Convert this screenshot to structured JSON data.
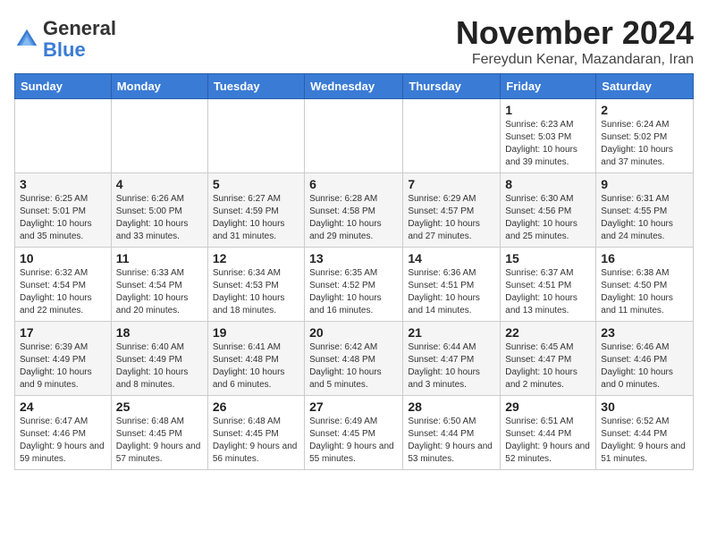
{
  "logo": {
    "general": "General",
    "blue": "Blue"
  },
  "header": {
    "month_title": "November 2024",
    "subtitle": "Fereydun Kenar, Mazandaran, Iran"
  },
  "days_of_week": [
    "Sunday",
    "Monday",
    "Tuesday",
    "Wednesday",
    "Thursday",
    "Friday",
    "Saturday"
  ],
  "weeks": [
    [
      {
        "day": "",
        "info": ""
      },
      {
        "day": "",
        "info": ""
      },
      {
        "day": "",
        "info": ""
      },
      {
        "day": "",
        "info": ""
      },
      {
        "day": "",
        "info": ""
      },
      {
        "day": "1",
        "info": "Sunrise: 6:23 AM\nSunset: 5:03 PM\nDaylight: 10 hours and 39 minutes."
      },
      {
        "day": "2",
        "info": "Sunrise: 6:24 AM\nSunset: 5:02 PM\nDaylight: 10 hours and 37 minutes."
      }
    ],
    [
      {
        "day": "3",
        "info": "Sunrise: 6:25 AM\nSunset: 5:01 PM\nDaylight: 10 hours and 35 minutes."
      },
      {
        "day": "4",
        "info": "Sunrise: 6:26 AM\nSunset: 5:00 PM\nDaylight: 10 hours and 33 minutes."
      },
      {
        "day": "5",
        "info": "Sunrise: 6:27 AM\nSunset: 4:59 PM\nDaylight: 10 hours and 31 minutes."
      },
      {
        "day": "6",
        "info": "Sunrise: 6:28 AM\nSunset: 4:58 PM\nDaylight: 10 hours and 29 minutes."
      },
      {
        "day": "7",
        "info": "Sunrise: 6:29 AM\nSunset: 4:57 PM\nDaylight: 10 hours and 27 minutes."
      },
      {
        "day": "8",
        "info": "Sunrise: 6:30 AM\nSunset: 4:56 PM\nDaylight: 10 hours and 25 minutes."
      },
      {
        "day": "9",
        "info": "Sunrise: 6:31 AM\nSunset: 4:55 PM\nDaylight: 10 hours and 24 minutes."
      }
    ],
    [
      {
        "day": "10",
        "info": "Sunrise: 6:32 AM\nSunset: 4:54 PM\nDaylight: 10 hours and 22 minutes."
      },
      {
        "day": "11",
        "info": "Sunrise: 6:33 AM\nSunset: 4:54 PM\nDaylight: 10 hours and 20 minutes."
      },
      {
        "day": "12",
        "info": "Sunrise: 6:34 AM\nSunset: 4:53 PM\nDaylight: 10 hours and 18 minutes."
      },
      {
        "day": "13",
        "info": "Sunrise: 6:35 AM\nSunset: 4:52 PM\nDaylight: 10 hours and 16 minutes."
      },
      {
        "day": "14",
        "info": "Sunrise: 6:36 AM\nSunset: 4:51 PM\nDaylight: 10 hours and 14 minutes."
      },
      {
        "day": "15",
        "info": "Sunrise: 6:37 AM\nSunset: 4:51 PM\nDaylight: 10 hours and 13 minutes."
      },
      {
        "day": "16",
        "info": "Sunrise: 6:38 AM\nSunset: 4:50 PM\nDaylight: 10 hours and 11 minutes."
      }
    ],
    [
      {
        "day": "17",
        "info": "Sunrise: 6:39 AM\nSunset: 4:49 PM\nDaylight: 10 hours and 9 minutes."
      },
      {
        "day": "18",
        "info": "Sunrise: 6:40 AM\nSunset: 4:49 PM\nDaylight: 10 hours and 8 minutes."
      },
      {
        "day": "19",
        "info": "Sunrise: 6:41 AM\nSunset: 4:48 PM\nDaylight: 10 hours and 6 minutes."
      },
      {
        "day": "20",
        "info": "Sunrise: 6:42 AM\nSunset: 4:48 PM\nDaylight: 10 hours and 5 minutes."
      },
      {
        "day": "21",
        "info": "Sunrise: 6:44 AM\nSunset: 4:47 PM\nDaylight: 10 hours and 3 minutes."
      },
      {
        "day": "22",
        "info": "Sunrise: 6:45 AM\nSunset: 4:47 PM\nDaylight: 10 hours and 2 minutes."
      },
      {
        "day": "23",
        "info": "Sunrise: 6:46 AM\nSunset: 4:46 PM\nDaylight: 10 hours and 0 minutes."
      }
    ],
    [
      {
        "day": "24",
        "info": "Sunrise: 6:47 AM\nSunset: 4:46 PM\nDaylight: 9 hours and 59 minutes."
      },
      {
        "day": "25",
        "info": "Sunrise: 6:48 AM\nSunset: 4:45 PM\nDaylight: 9 hours and 57 minutes."
      },
      {
        "day": "26",
        "info": "Sunrise: 6:48 AM\nSunset: 4:45 PM\nDaylight: 9 hours and 56 minutes."
      },
      {
        "day": "27",
        "info": "Sunrise: 6:49 AM\nSunset: 4:45 PM\nDaylight: 9 hours and 55 minutes."
      },
      {
        "day": "28",
        "info": "Sunrise: 6:50 AM\nSunset: 4:44 PM\nDaylight: 9 hours and 53 minutes."
      },
      {
        "day": "29",
        "info": "Sunrise: 6:51 AM\nSunset: 4:44 PM\nDaylight: 9 hours and 52 minutes."
      },
      {
        "day": "30",
        "info": "Sunrise: 6:52 AM\nSunset: 4:44 PM\nDaylight: 9 hours and 51 minutes."
      }
    ]
  ]
}
